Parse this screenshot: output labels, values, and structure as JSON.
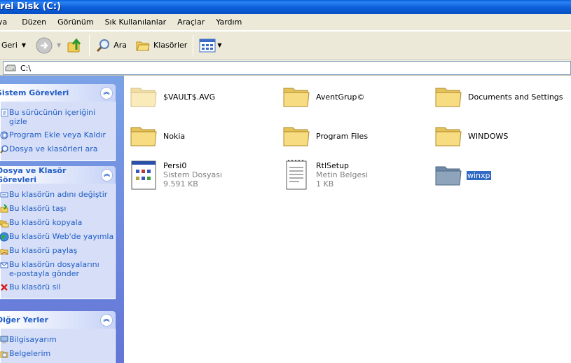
{
  "window": {
    "title": "Yerel Disk (C:)"
  },
  "menu": [
    "Dosya",
    "Düzen",
    "Görünüm",
    "Sık Kullanılanlar",
    "Araçlar",
    "Yardım"
  ],
  "toolbar": {
    "back": "Geri",
    "search": "Ara",
    "folders": "Klasörler"
  },
  "address": {
    "value": "C:\\"
  },
  "left": {
    "system": {
      "title": "Sistem Görevleri",
      "items": [
        "Bu sürücünün içeriğini gizle",
        "Program Ekle veya Kaldır",
        "Dosya ve klasörleri ara"
      ]
    },
    "folder": {
      "title": "Dosya ve Klasör Görevleri",
      "items": [
        "Bu klasörün adını değiştir",
        "Bu klasörü taşı",
        "Bu klasörü kopyala",
        "Bu klasörü Web'de yayımla",
        "Bu klasörü paylaş",
        "Bu klasörün dosyalarını",
        "e-postayla gönder",
        "Bu klasörü sil"
      ]
    },
    "other": {
      "title": "Diğer Yerler",
      "items": [
        "Bilgisayarım",
        "Belgelerim"
      ]
    }
  },
  "files": [
    {
      "name": "$VAULT$.AVG"
    },
    {
      "name": "AventGrup©"
    },
    {
      "name": "Documents and Settings"
    },
    {
      "name": "Nokia"
    },
    {
      "name": "Program Files"
    },
    {
      "name": "WINDOWS"
    },
    {
      "name": "Persi0",
      "type": "Sistem Dosyası",
      "size": "9.591 KB"
    },
    {
      "name": "RtlSetup",
      "type": "Metin Belgesi",
      "size": "1 KB"
    },
    {
      "name": "winxp"
    }
  ],
  "colors": {
    "titlebar": "#0c5ed8",
    "link": "#215dc6",
    "selection": "#316ac5",
    "folder": "#f7d76b"
  }
}
